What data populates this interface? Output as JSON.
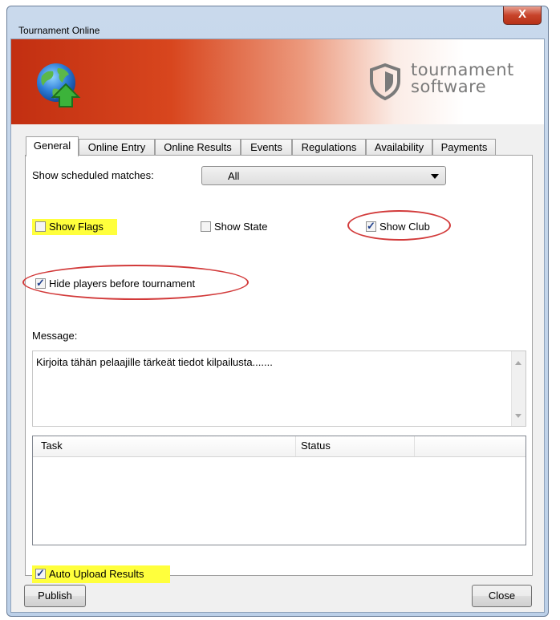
{
  "window": {
    "title": "Tournament Online",
    "close_glyph": "X"
  },
  "banner": {
    "logo_line1": "tournament",
    "logo_line2": "software",
    "globe_icon": "globe-upload-icon",
    "shield_icon": "shield-logo-icon"
  },
  "tabs": [
    {
      "label": "General",
      "active": true
    },
    {
      "label": "Online Entry"
    },
    {
      "label": "Online Results"
    },
    {
      "label": "Events"
    },
    {
      "label": "Regulations"
    },
    {
      "label": "Availability"
    },
    {
      "label": "Payments"
    }
  ],
  "general": {
    "scheduled_label": "Show scheduled matches:",
    "scheduled_value": "All",
    "show_flags": {
      "label": "Show Flags",
      "checked": false
    },
    "show_state": {
      "label": "Show State",
      "checked": false
    },
    "show_club": {
      "label": "Show Club",
      "checked": true
    },
    "hide_players": {
      "label": "Hide players before tournament",
      "checked": true
    },
    "message_label": "Message:",
    "message_text": "Kirjoita tähän pelaajille tärkeät tiedot kilpailusta.......",
    "task_columns": [
      "Task",
      "Status"
    ],
    "auto_upload": {
      "label": "Auto Upload Results",
      "checked": true
    }
  },
  "buttons": {
    "publish": "Publish",
    "close": "Close"
  },
  "colors": {
    "highlight": "#ffff3c",
    "annotation_circle": "#d23a3a",
    "banner_red": "#c22f11"
  }
}
